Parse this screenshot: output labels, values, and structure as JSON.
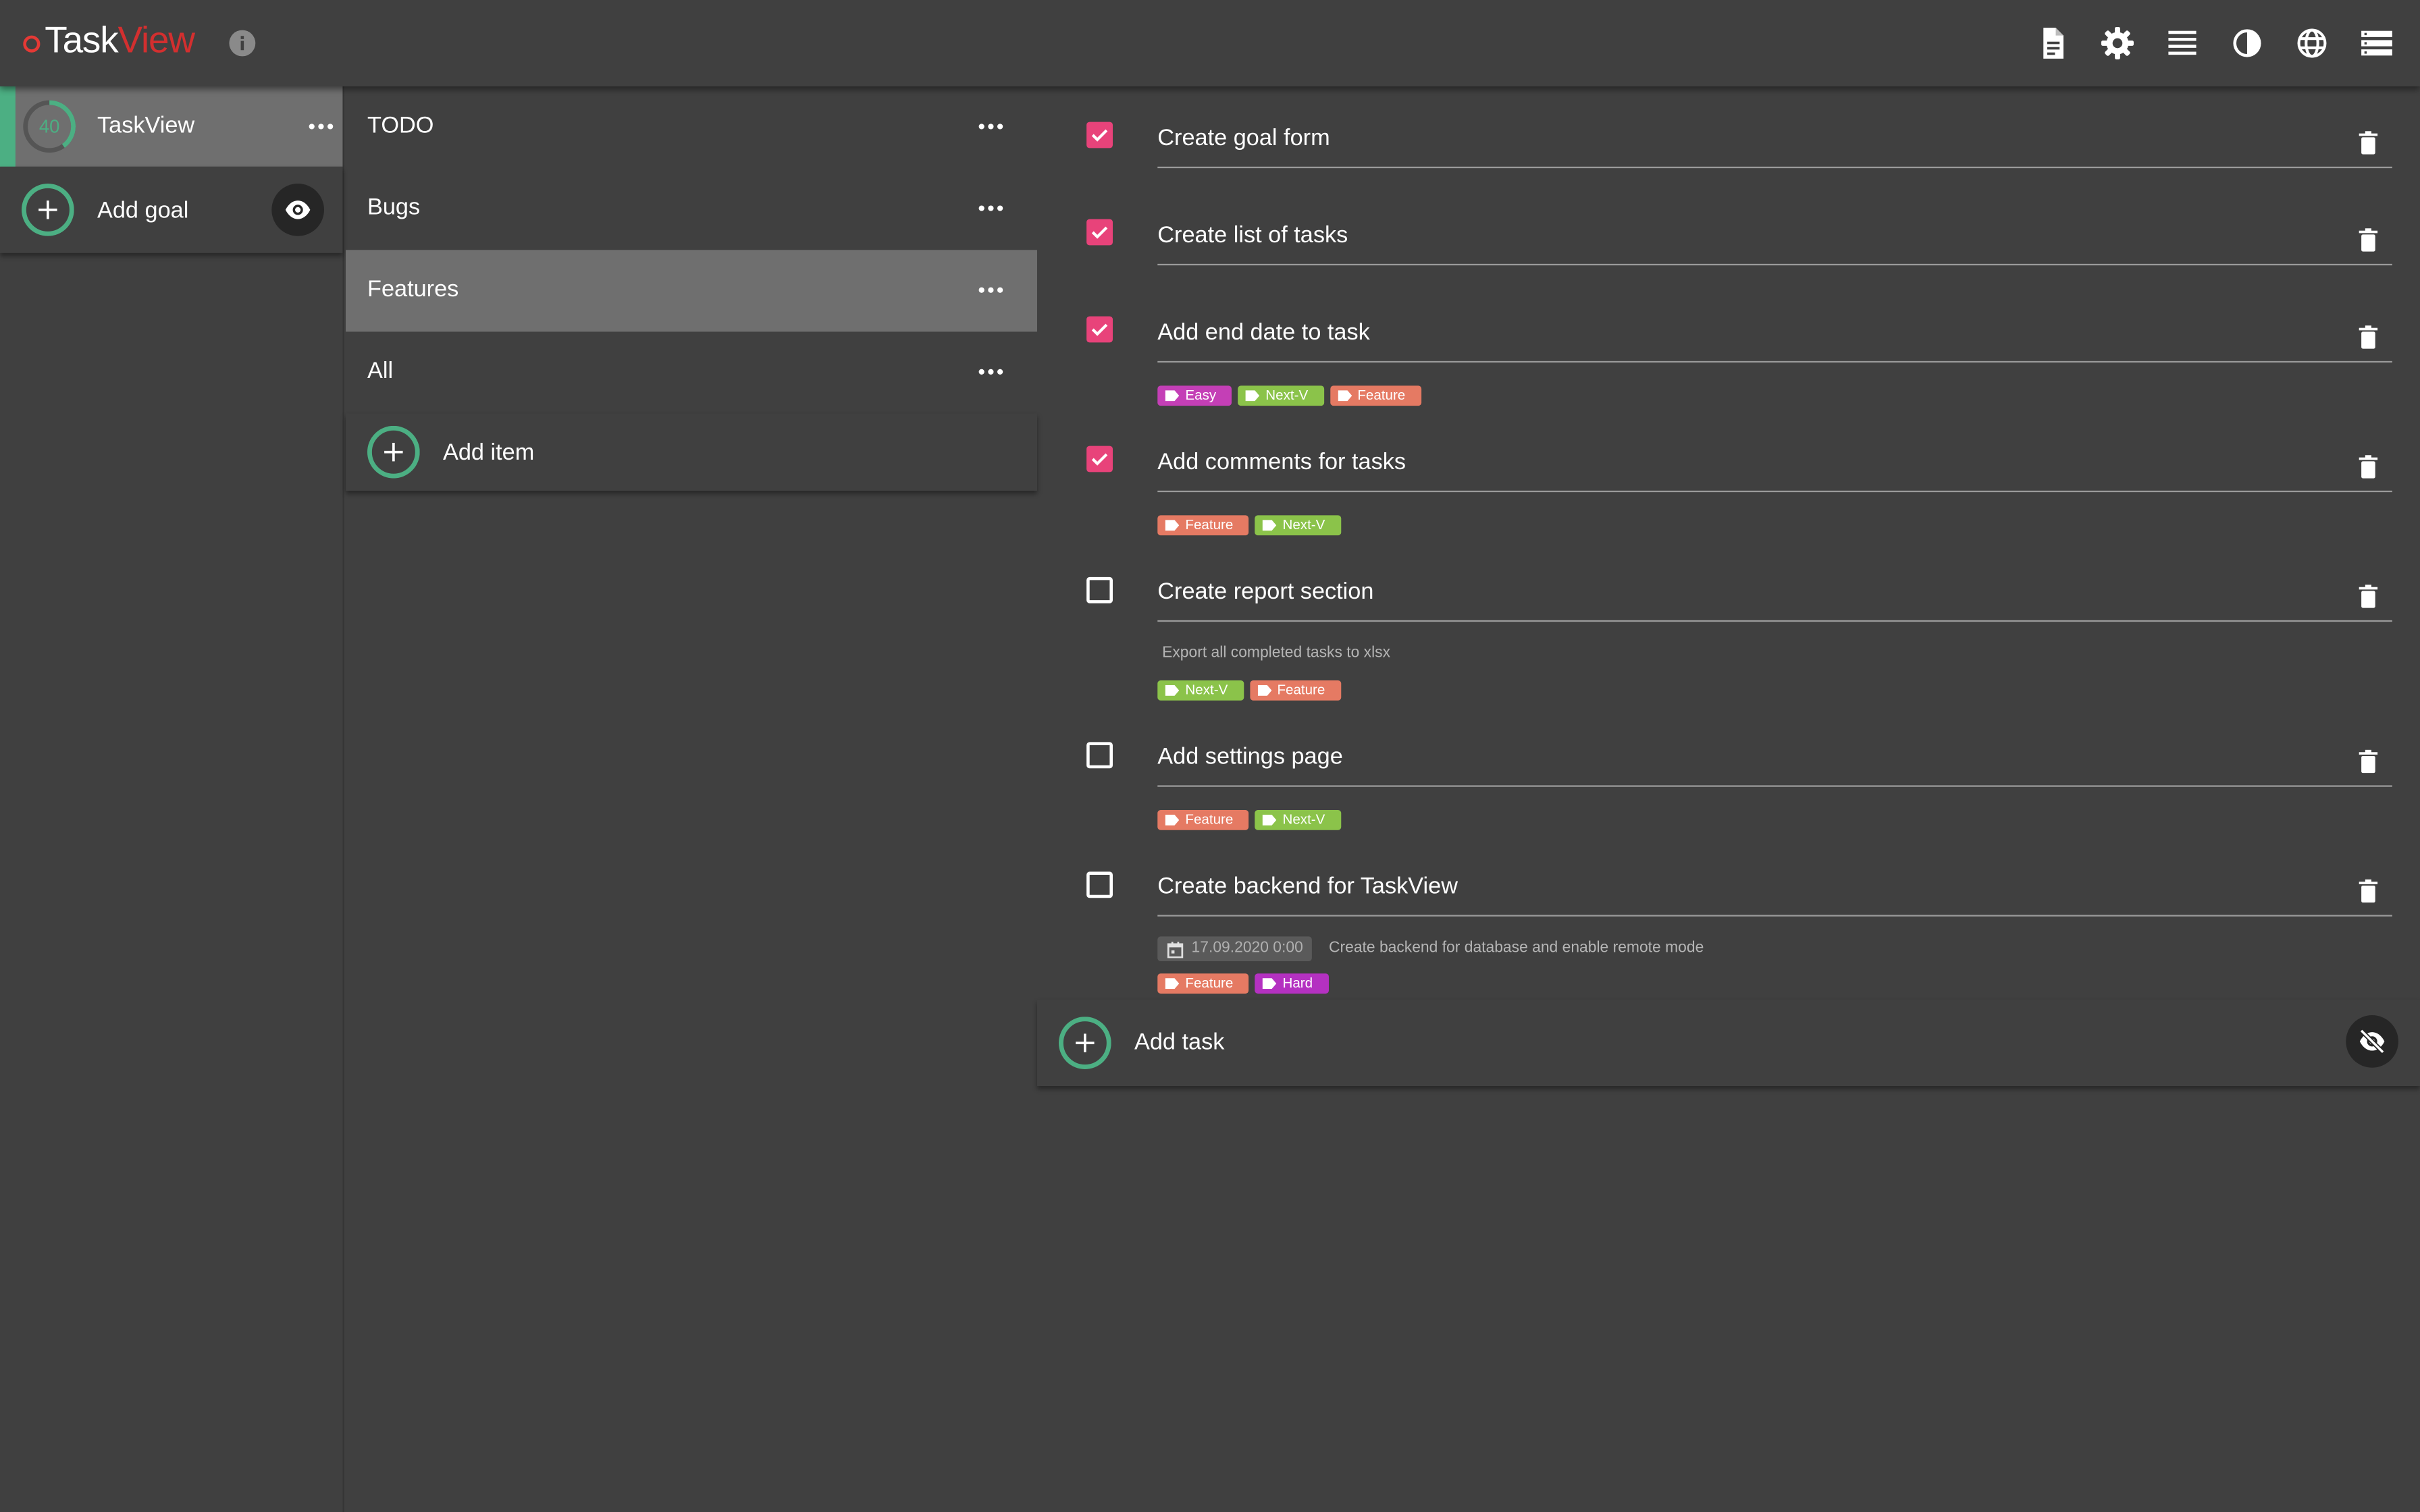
{
  "app": {
    "logo_task": "Task",
    "logo_view": "View"
  },
  "header_icons": [
    "document-icon",
    "gear-icon",
    "list-lines-icon",
    "contrast-icon",
    "globe-icon",
    "storage-icon"
  ],
  "colors": {
    "accent_green": "#4caf83",
    "checkbox_pink": "#e8437a",
    "logo_red": "#d32f2f",
    "tag_easy": "#c43fb6",
    "tag_nextv": "#8bc34a",
    "tag_feature": "#e57a63",
    "tag_hard": "#b431c1"
  },
  "goals": {
    "items": [
      {
        "title": "TaskView",
        "progress": 40,
        "progress_label": "40"
      }
    ],
    "add_label": "Add goal"
  },
  "lists": {
    "items": [
      {
        "label": "TODO"
      },
      {
        "label": "Bugs"
      },
      {
        "label": "Features",
        "active": true
      },
      {
        "label": "All"
      }
    ],
    "add_label": "Add item"
  },
  "tasks": {
    "items": [
      {
        "title": "Create goal form",
        "done": true
      },
      {
        "title": "Create list of tasks",
        "done": true
      },
      {
        "title": "Add end date to task",
        "done": true,
        "tags": [
          "Easy",
          "Next-V",
          "Feature"
        ]
      },
      {
        "title": "Add comments for tasks",
        "done": true,
        "tags": [
          "Feature",
          "Next-V"
        ]
      },
      {
        "title": "Create report section",
        "done": false,
        "description": "Export all completed tasks to xlsx",
        "tags": [
          "Next-V",
          "Feature"
        ]
      },
      {
        "title": "Add settings page",
        "done": false,
        "tags": [
          "Feature",
          "Next-V"
        ]
      },
      {
        "title": "Create backend for TaskView",
        "done": false,
        "date": "17.09.2020 0:00",
        "description": "Create backend for database and enable remote mode",
        "tags": [
          "Feature",
          "Hard"
        ]
      }
    ],
    "add_label": "Add task"
  }
}
